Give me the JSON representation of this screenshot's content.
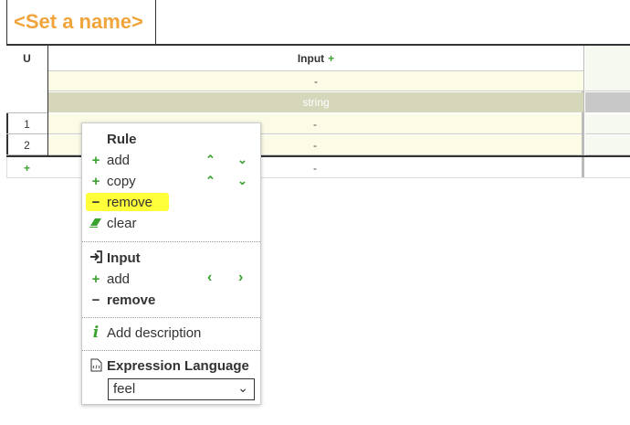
{
  "table": {
    "name": "<Set a name>",
    "hit_policy": "U",
    "input": {
      "label": "Input",
      "add_symbol": "+",
      "expression": "-",
      "type": "string"
    },
    "rows": [
      {
        "number": "1",
        "value": "-"
      },
      {
        "number": "2",
        "value": "-"
      }
    ],
    "add_row_symbol": "+",
    "add_row_value": "-"
  },
  "context_menu": {
    "rule_section": {
      "title": "Rule",
      "add_label": "add",
      "copy_label": "copy",
      "remove_label": "remove",
      "clear_label": "clear"
    },
    "input_section": {
      "title": "Input",
      "add_label": "add",
      "remove_label": "remove"
    },
    "description_label": "Add description",
    "expression_language": {
      "title": "Expression Language",
      "selected": "feel"
    },
    "icons": {
      "add": "+",
      "remove": "−",
      "up": "⌃",
      "down": "⌄",
      "left": "‹",
      "right": "›",
      "chevron": "⌄"
    }
  },
  "colors": {
    "accent_orange": "#f0a53c",
    "accent_green": "#3aa32f",
    "highlight_yellow": "#ffff3a",
    "input_row_bg": "#fbfbe6",
    "type_row_bg": "#d6d6bb"
  }
}
